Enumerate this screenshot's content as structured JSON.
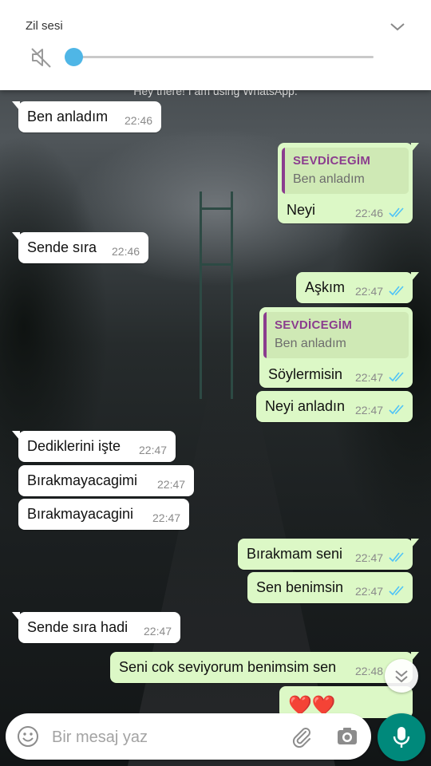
{
  "volume": {
    "title": "Zil sesi",
    "level": 0.0
  },
  "status_peek": "Hey there! I am using WhatsApp.",
  "colors": {
    "incoming_bubble": "#ffffff",
    "outgoing_bubble": "#dcf8c6",
    "quote_name": "#8b3d8e",
    "read_ticks": "#4fc3f7",
    "mic_button": "#00897b"
  },
  "messages": [
    {
      "dir": "in",
      "text": "Ben anladım",
      "time": "22:46"
    },
    {
      "dir": "out",
      "quote_name": "SEVDİCEGİM",
      "quote_text": "Ben anladım",
      "text": "Neyi",
      "time": "22:46",
      "status": "read"
    },
    {
      "dir": "in",
      "text": "Sende sıra",
      "time": "22:46"
    },
    {
      "dir": "out",
      "text": "Aşkım",
      "time": "22:47",
      "status": "read"
    },
    {
      "dir": "out",
      "quote_name": "SEVDİCEGİM",
      "quote_text": "Ben anladım",
      "text": "Söylermisin",
      "time": "22:47",
      "status": "read"
    },
    {
      "dir": "out",
      "text": "Neyi anladın",
      "time": "22:47",
      "status": "read"
    },
    {
      "dir": "in",
      "text": "Dediklerini işte",
      "time": "22:47"
    },
    {
      "dir": "in",
      "text": "Bırakmayacagimi",
      "time": "22:47"
    },
    {
      "dir": "in",
      "text": "Bırakmayacagini",
      "time": "22:47"
    },
    {
      "dir": "out",
      "text": "Bırakmam seni",
      "time": "22:47",
      "status": "read"
    },
    {
      "dir": "out",
      "text": "Sen benimsin",
      "time": "22:47",
      "status": "read"
    },
    {
      "dir": "in",
      "text": "Sende sıra hadi",
      "time": "22:47"
    },
    {
      "dir": "out",
      "text": "Seni cok seviyorum benimsim sen",
      "time": "22:48",
      "status": "read"
    },
    {
      "dir": "out",
      "text": "❤️❤️",
      "time": "",
      "status": ""
    }
  ],
  "composer": {
    "placeholder": "Bir mesaj yaz",
    "value": "",
    "icons": [
      "emoji-icon",
      "attach-icon",
      "camera-icon",
      "mic-icon"
    ]
  },
  "scroll_fab_icon": "double-chevron-down-icon"
}
